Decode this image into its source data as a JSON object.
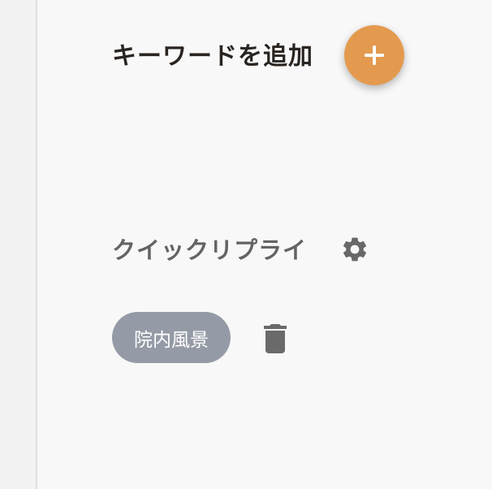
{
  "add_keyword": {
    "label": "キーワードを追加",
    "button_icon": "plus-icon",
    "button_color": "#e39a4e"
  },
  "quick_reply": {
    "title": "クイックリプライ",
    "settings_icon": "gear-icon",
    "items": [
      {
        "label": "院内風景",
        "delete_icon": "trash-icon"
      }
    ],
    "chip_color": "#959ba6"
  }
}
